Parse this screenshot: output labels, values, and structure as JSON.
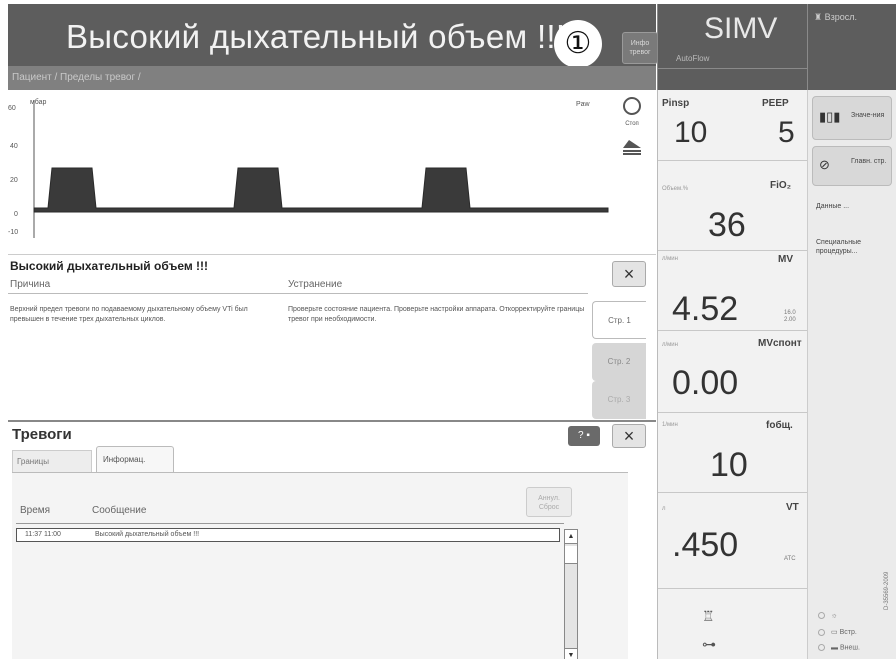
{
  "header": {
    "alarm_title": "Высокий дыхательный объем !!!",
    "callout": "①",
    "info_button": "Инфо тревог",
    "breadcrumb": "Пациент / Пределы тревог /"
  },
  "mode": {
    "name": "SIMV",
    "sub": "AutoFlow"
  },
  "patient": {
    "label": "Взросл."
  },
  "waveform": {
    "unit": "мбар",
    "label": "Paw",
    "y_ticks": [
      "60",
      "40",
      "20",
      "0",
      "-10"
    ],
    "tools": [
      {
        "icon": "stop-icon",
        "label": "Стоп"
      },
      {
        "icon": "waveform-config-icon",
        "label": ""
      }
    ]
  },
  "alarm_detail": {
    "title": "Высокий дыхательный объем !!!",
    "cause_heading": "Причина",
    "fix_heading": "Устранение",
    "cause_text": "Верхний предел тревоги по подаваемому дыхательному объему VTi был превышен в течение трех дыхательных циклов.",
    "fix_text": "Проверьте состояние пациента. Проверьте настройки аппарата. Откорректируйте границы тревог при необходимости.",
    "close": "×",
    "page_tabs": [
      "Стр. 1",
      "Стр. 2",
      "Стр. 3"
    ]
  },
  "alarms": {
    "title": "Тревоги",
    "help": "? ▪",
    "close": "×",
    "tabs": [
      "Границы",
      "Информац."
    ],
    "col_time": "Время",
    "col_message": "Сообщение",
    "clear_button": "Аннул. Сброс",
    "log": [
      {
        "time": "11:37  11:00",
        "message": "Высокий дыхательный объем !!!"
      }
    ],
    "scroll_up": "▲",
    "scroll_down": "▼"
  },
  "params": {
    "pinsp_label": "Pinsp",
    "pinsp_value": "10",
    "peep_label": "PEEP",
    "peep_value": "5",
    "fio2_label": "FiO₂",
    "fio2_unit": "Объем.%",
    "fio2_value": "36",
    "mv_label": "MV",
    "mv_unit": "л/мин",
    "mv_value": "4.52",
    "mv_limits": [
      "16.0",
      "2.00"
    ],
    "mvspont_label": "MVспонт",
    "mvspont_unit": "л/мин",
    "mvspont_value": "0.00",
    "fresp_label": "fобщ.",
    "fresp_unit": "1/мин",
    "fresp_value": "10",
    "vt_label": "VT",
    "vt_unit": "л",
    "vt_value": ".450",
    "vt_limit": "ATC"
  },
  "menu": {
    "buttons": [
      {
        "icon": "values-icon",
        "label": "Значе-ния"
      },
      {
        "icon": "home-icon",
        "label": "Главн. стр."
      },
      {
        "icon": "",
        "label": "Данные ..."
      },
      {
        "icon": "",
        "label": "Специальные процедуры..."
      }
    ],
    "radios": [
      {
        "icon": "sun-icon",
        "label": "☼"
      },
      {
        "icon": "battery-icon",
        "label": "Встр."
      },
      {
        "icon": "battery-ext-icon",
        "label": "Внеш."
      }
    ]
  },
  "figure_id": "D-35569-2009",
  "colors": {
    "header_bg": "#5d5d5d",
    "crumb_bg": "#808080",
    "waveform_fill": "#3a3a3a",
    "panel_bg": "#f2f2f2"
  }
}
